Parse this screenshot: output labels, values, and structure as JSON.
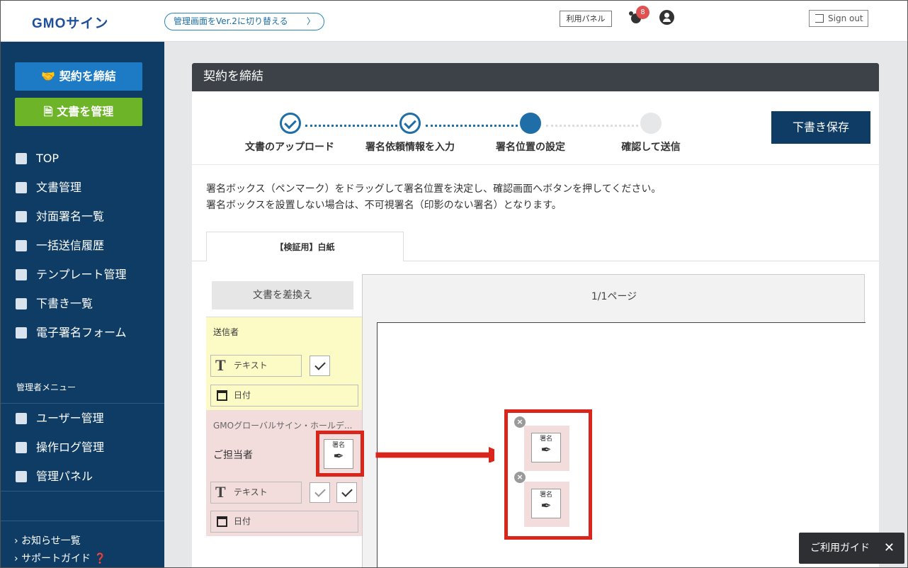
{
  "header": {
    "logo": "GMOサイン",
    "switch_label": "管理画面をVer.2に切り替える",
    "switch_chevron": "〉",
    "panel_label": "利用パネル",
    "notification_count": "8",
    "signout_label": "Sign out"
  },
  "sidebar": {
    "primary_buttons": [
      {
        "label": "契約を締結",
        "icon": "handshake-icon"
      },
      {
        "label": "文書を管理",
        "icon": "document-icon"
      }
    ],
    "items": [
      {
        "label": "TOP",
        "icon": "home-icon"
      },
      {
        "label": "文書管理",
        "icon": "file-icon"
      },
      {
        "label": "対面署名一覧",
        "icon": "people-icon"
      },
      {
        "label": "一括送信履歴",
        "icon": "bulk-send-icon"
      },
      {
        "label": "テンプレート管理",
        "icon": "template-icon"
      },
      {
        "label": "下書き一覧",
        "icon": "draft-icon"
      },
      {
        "label": "電子署名フォーム",
        "icon": "link-icon"
      }
    ],
    "admin_heading": "管理者メニュー",
    "admin_items": [
      {
        "label": "ユーザー管理",
        "icon": "user-icon"
      },
      {
        "label": "操作ログ管理",
        "icon": "log-icon"
      },
      {
        "label": "管理パネル",
        "icon": "admin-panel-icon"
      }
    ],
    "footer_links": [
      "お知らせ一覧",
      "サポートガイド"
    ]
  },
  "main": {
    "title": "契約を締結",
    "steps": [
      {
        "label": "文書のアップロード",
        "state": "done"
      },
      {
        "label": "署名依頼情報を入力",
        "state": "done"
      },
      {
        "label": "署名位置の設定",
        "state": "current"
      },
      {
        "label": "確認して送信",
        "state": "todo"
      }
    ],
    "save_draft": "下書き保存",
    "instructions": [
      "署名ボックス（ペンマーク）をドラッグして署名位置を決定し、確認画面へボタンを押してください。",
      "署名ボックスを設置しない場合は、不可視署名（印影のない署名）となります。"
    ],
    "document_tab": "【検証用】白紙",
    "swap_button": "文書を差換え",
    "sender": {
      "heading": "送信者",
      "text_field": "テキスト",
      "date_field": "日付"
    },
    "recipient": {
      "company": "GMOグローバルサイン・ホールデ...",
      "person": "ご担当者",
      "signature_label": "署名",
      "text_field": "テキスト",
      "date_field": "日付"
    },
    "page_indicator": "1/1ページ",
    "placed_signature_label": "署名",
    "placed_remove": "×"
  },
  "guide": {
    "label": "ご利用ガイド",
    "close": "✕"
  },
  "colors": {
    "navy": "#0e3c65",
    "blue": "#1d7bc6",
    "green": "#6eb428",
    "highlight": "#d9261c"
  }
}
